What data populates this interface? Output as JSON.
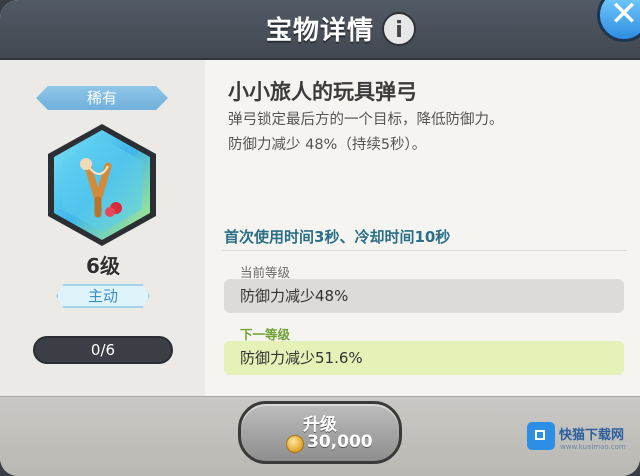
{
  "header": {
    "title": "宝物详情",
    "info_icon": "info-icon",
    "close_icon": "close-icon"
  },
  "item": {
    "rarity": "稀有",
    "level": "6级",
    "type": "主动",
    "progress": "0/6",
    "name": "小小旅人的玩具弹弓",
    "desc_line1": "弹弓锁定最后方的一个目标，降低防御力。",
    "desc_line2": "防御力减少 48%（持续5秒）。",
    "cooldown": "首次使用时间3秒、冷却时间10秒"
  },
  "levels": {
    "current_label": "当前等级",
    "current_value": "防御力减少48%",
    "next_label": "下一等级",
    "next_value": "防御力减少51.6%"
  },
  "upgrade": {
    "label": "升级",
    "price": "30,000"
  },
  "watermark": {
    "name": "快猫下载网",
    "sub": "www.kuaimao.com"
  },
  "colors": {
    "header_bg": "#4b5059",
    "accent_blue": "#2b6f86",
    "next_level_bg": "#e4f1b7"
  }
}
